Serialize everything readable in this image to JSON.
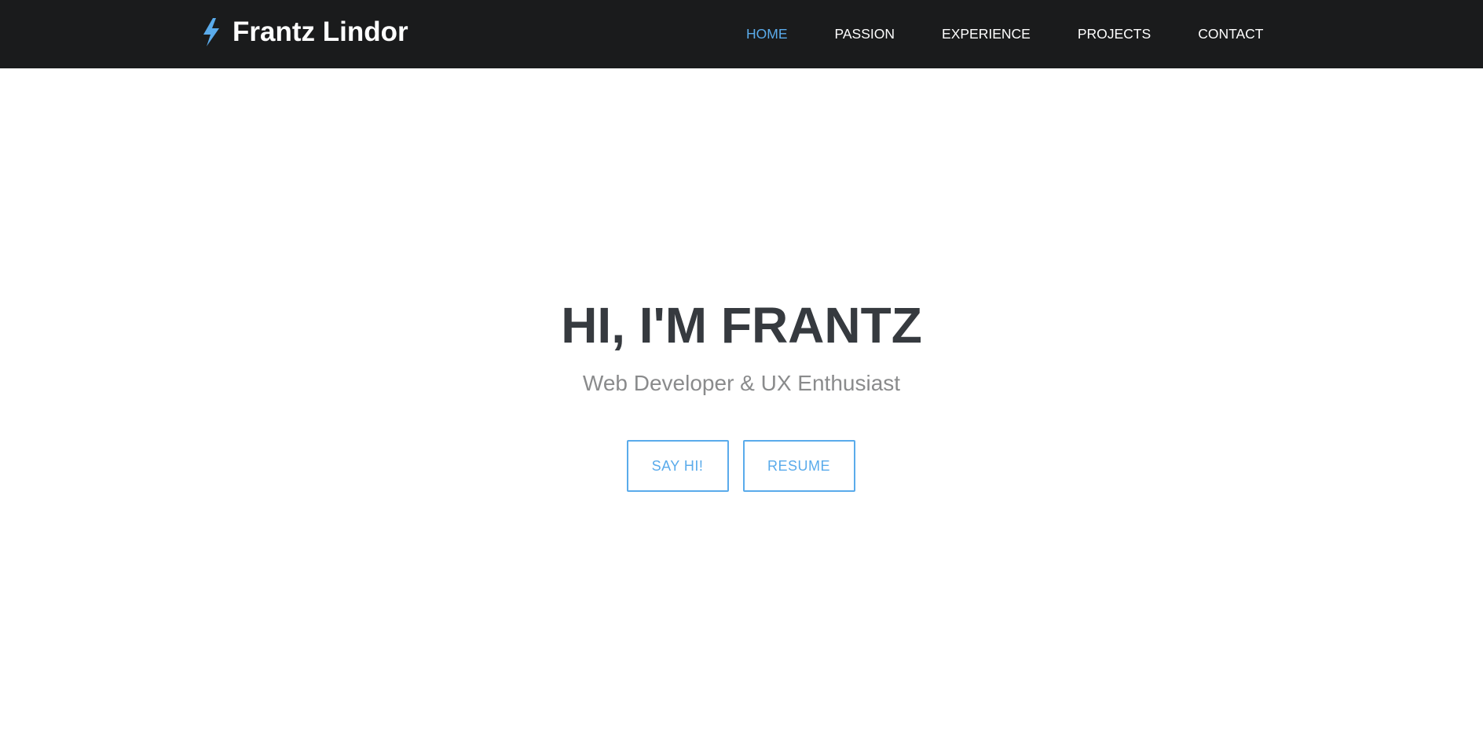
{
  "brand": {
    "name": "Frantz Lindor",
    "icon": "lightning-bolt-icon",
    "icon_color": "#5aabeb"
  },
  "nav": {
    "items": [
      {
        "label": "HOME",
        "active": true
      },
      {
        "label": "PASSION",
        "active": false
      },
      {
        "label": "EXPERIENCE",
        "active": false
      },
      {
        "label": "PROJECTS",
        "active": false
      },
      {
        "label": "CONTACT",
        "active": false
      }
    ]
  },
  "hero": {
    "title": "HI, I'M FRANTZ",
    "subtitle": "Web Developer & UX Enthusiast",
    "buttons": {
      "say_hi": "SAY HI!",
      "resume": "RESUME"
    }
  },
  "colors": {
    "navbar_bg": "#1a1b1c",
    "accent": "#5aabeb",
    "title": "#363a3f",
    "subtitle": "#8a8b8c",
    "background": "#ffffff"
  }
}
